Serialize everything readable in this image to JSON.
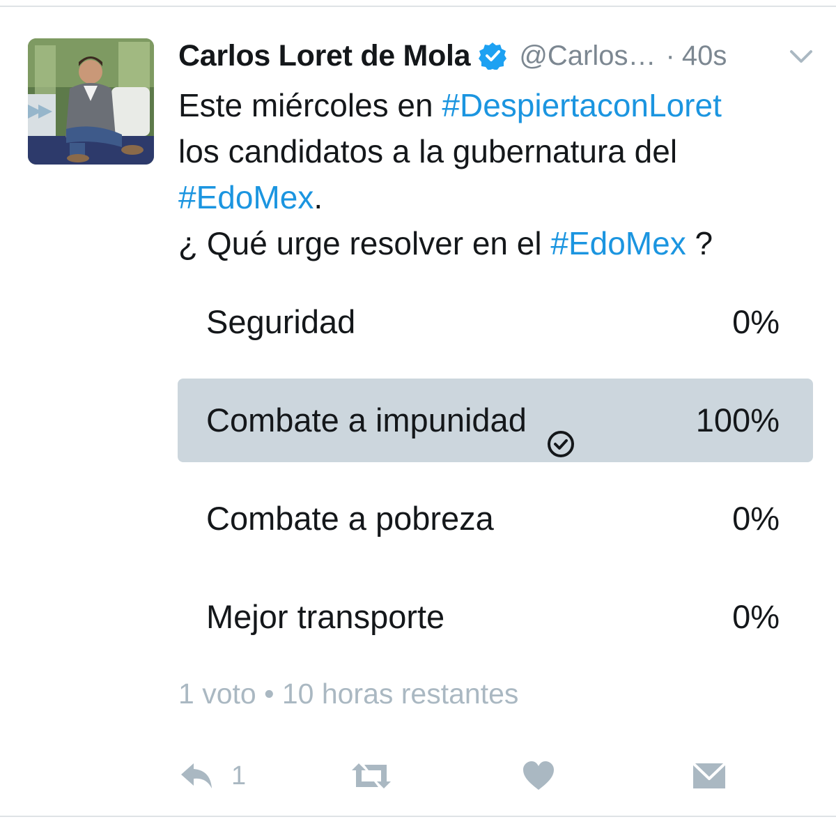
{
  "tweet": {
    "display_name": "Carlos Loret de Mola",
    "handle": "@Carlos…",
    "separator": "·",
    "time": "40s",
    "text_lines": [
      [
        {
          "t": "Este miércoles en ",
          "tag": false
        },
        {
          "t": "#DespiertaconLoret",
          "tag": true
        }
      ],
      [
        {
          "t": "los candidatos a la gubernatura del",
          "tag": false
        }
      ],
      [
        {
          "t": "#EdoMex",
          "tag": true
        },
        {
          "t": ".",
          "tag": false
        }
      ],
      [
        {
          "t": "¿ Qué urge resolver en el ",
          "tag": false
        },
        {
          "t": "#EdoMex",
          "tag": true
        },
        {
          "t": " ?",
          "tag": false
        }
      ]
    ]
  },
  "poll": {
    "options": [
      {
        "label": "Seguridad",
        "percent_label": "0%",
        "share": 0,
        "chosen": false
      },
      {
        "label": "Combate a impunidad",
        "percent_label": "100%",
        "share": 1,
        "chosen": true
      },
      {
        "label": "Combate a pobreza",
        "percent_label": "0%",
        "share": 0,
        "chosen": false
      },
      {
        "label": "Mejor transporte",
        "percent_label": "0%",
        "share": 0,
        "chosen": false
      }
    ],
    "meta": "1 voto • 10 horas restantes"
  },
  "actions": {
    "reply_count": "1"
  },
  "icons": {
    "verified": "verified-badge-icon",
    "caret": "chevron-down-icon",
    "check": "check-circle-icon",
    "reply": "reply-icon",
    "retweet": "retweet-icon",
    "like": "heart-icon",
    "dm": "envelope-icon"
  },
  "colors": {
    "hashtag": "#1b95e0",
    "verified": "#1da1f2",
    "poll_fill": "#ccd6dd",
    "muted": "#aab8c2"
  }
}
